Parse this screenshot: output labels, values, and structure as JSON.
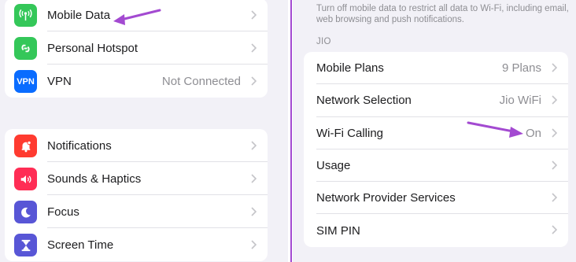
{
  "left": {
    "group1": [
      {
        "label": "Mobile Data",
        "icon": "antenna-icon",
        "color": "#34c759",
        "value": ""
      },
      {
        "label": "Personal Hotspot",
        "icon": "hotspot-link-icon",
        "color": "#34c759",
        "value": ""
      },
      {
        "label": "VPN",
        "icon": "vpn-icon",
        "color": "#0a6cff",
        "value": "Not Connected",
        "icon_text": "VPN"
      }
    ],
    "group2": [
      {
        "label": "Notifications",
        "icon": "bell-icon",
        "color": "#ff3b30",
        "value": ""
      },
      {
        "label": "Sounds & Haptics",
        "icon": "speaker-icon",
        "color": "#ff2d55",
        "value": ""
      },
      {
        "label": "Focus",
        "icon": "moon-icon",
        "color": "#5856d6",
        "value": ""
      },
      {
        "label": "Screen Time",
        "icon": "hourglass-icon",
        "color": "#5856d6",
        "value": ""
      }
    ]
  },
  "right": {
    "description": "Turn off mobile data to restrict all data to Wi-Fi, including email, web browsing and push notifications.",
    "section_header": "JIO",
    "rows": [
      {
        "label": "Mobile Plans",
        "value": "9 Plans"
      },
      {
        "label": "Network Selection",
        "value": "Jio WiFi"
      },
      {
        "label": "Wi-Fi Calling",
        "value": "On"
      },
      {
        "label": "Usage",
        "value": ""
      },
      {
        "label": "Network Provider Services",
        "value": ""
      },
      {
        "label": "SIM PIN",
        "value": ""
      }
    ]
  },
  "colors": {
    "annotation_arrow": "#a34ad1",
    "divider": "#a34ad1",
    "background": "#f2f1f7"
  }
}
